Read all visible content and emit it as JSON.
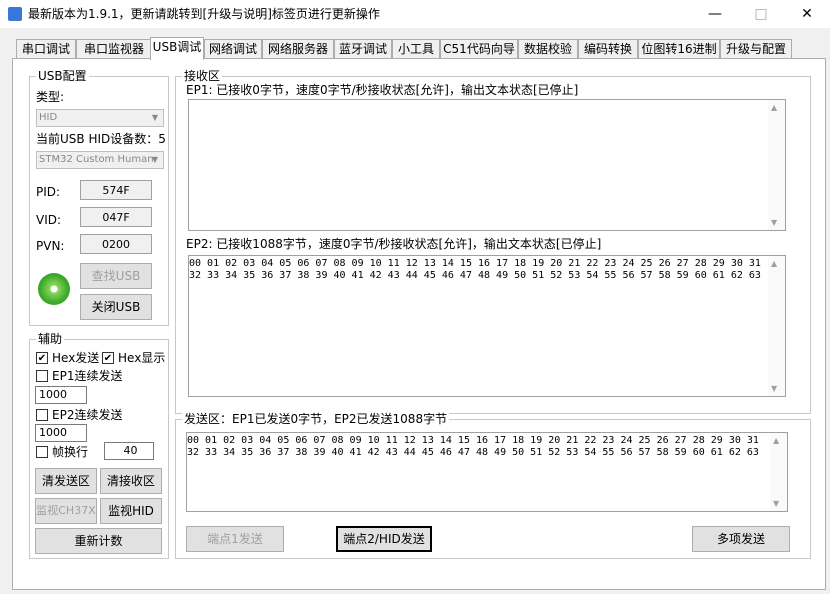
{
  "window": {
    "title": "最新版本为1.9.1，更新请跳转到[升级与说明]标签页进行更新操作",
    "minimize": "—",
    "maximize": "□",
    "close": "✕"
  },
  "tabs": [
    "串口调试",
    "串口监视器",
    "USB调试",
    "网络调试",
    "网络服务器",
    "蓝牙调试",
    "小工具",
    "C51代码向导",
    "数据校验",
    "编码转换",
    "位图转16进制",
    "升级与配置"
  ],
  "usb_config": {
    "group_label": "USB配置",
    "type_label": "类型:",
    "type_value": "HID",
    "device_count_label": "当前USB HID设备数：5",
    "device_value": "STM32 Custom Human",
    "pid_label": "PID:",
    "pid_value": "574F",
    "vid_label": "VID:",
    "vid_value": "047F",
    "pvn_label": "PVN:",
    "pvn_value": "0200",
    "find_usb": "查找USB",
    "close_usb": "关闭USB"
  },
  "assist": {
    "group_label": "辅助",
    "hex_send": "Hex发送",
    "hex_display": "Hex显示",
    "ep1_continuous": "EP1连续发送",
    "ep1_interval": "1000",
    "ep2_continuous": "EP2连续发送",
    "ep2_interval": "1000",
    "frame_wrap": "帧换行",
    "frame_wrap_value": "40",
    "clear_send": "清发送区",
    "clear_receive": "清接收区",
    "monitor_ch37x": "监视CH37X",
    "monitor_hid": "监视HID",
    "reset_count": "重新计数"
  },
  "receive": {
    "group_label": "接收区",
    "ep1_status": "EP1: 已接收0字节，速度0字节/秒接收状态[允许]，输出文本状态[已停止]",
    "ep1_text": "",
    "ep2_status": "EP2: 已接收1088字节，速度0字节/秒接收状态[允许]，输出文本状态[已停止]",
    "ep2_text": "00 01 02 03 04 05 06 07 08 09 10 11 12 13 14 15 16 17 18 19 20 21 22 23 24 25 26 27 28 29 30 31\n32 33 34 35 36 37 38 39 40 41 42 43 44 45 46 47 48 49 50 51 52 53 54 55 56 57 58 59 60 61 62 63"
  },
  "send": {
    "group_label": "发送区：EP1已发送0字节，EP2已发送1088字节",
    "text": "00 01 02 03 04 05 06 07 08 09 10 11 12 13 14 15 16 17 18 19 20 21 22 23 24 25 26 27 28 29 30 31\n32 33 34 35 36 37 38 39 40 41 42 43 44 45 46 47 48 49 50 51 52 53 54 55 56 57 58 59 60 61 62 63",
    "ep1_send": "端点1发送",
    "ep2_send": "端点2/HID发送",
    "multi_send": "多项发送"
  }
}
